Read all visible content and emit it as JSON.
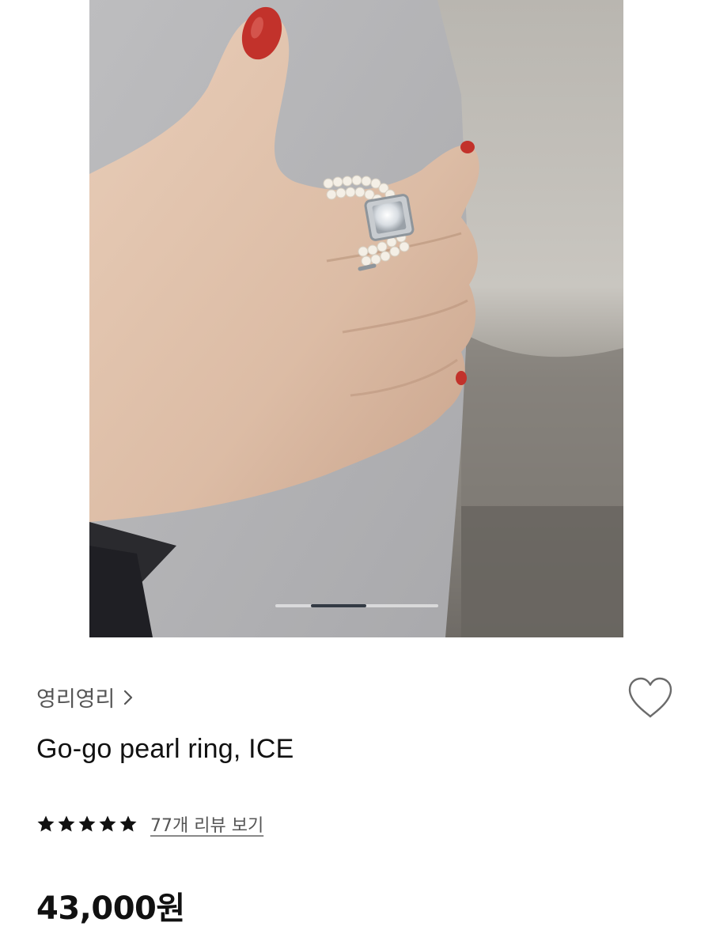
{
  "product": {
    "brand": "영리영리",
    "title": "Go-go pearl ring, ICE",
    "rating": 5,
    "max_rating": 5,
    "review_link": "77개 리뷰 보기",
    "price": "43,000원"
  },
  "gallery": {
    "image_subject": "hand wearing pearl ring with square clear stone",
    "slide_position": 0.33
  },
  "icons": {
    "brand_chevron": "chevron-right-icon",
    "wishlist": "heart-outline-icon",
    "star": "star-filled-icon"
  },
  "colors": {
    "text_primary": "#111111",
    "text_secondary": "#555555",
    "indicator_active": "#333a44",
    "background": "#ffffff"
  }
}
